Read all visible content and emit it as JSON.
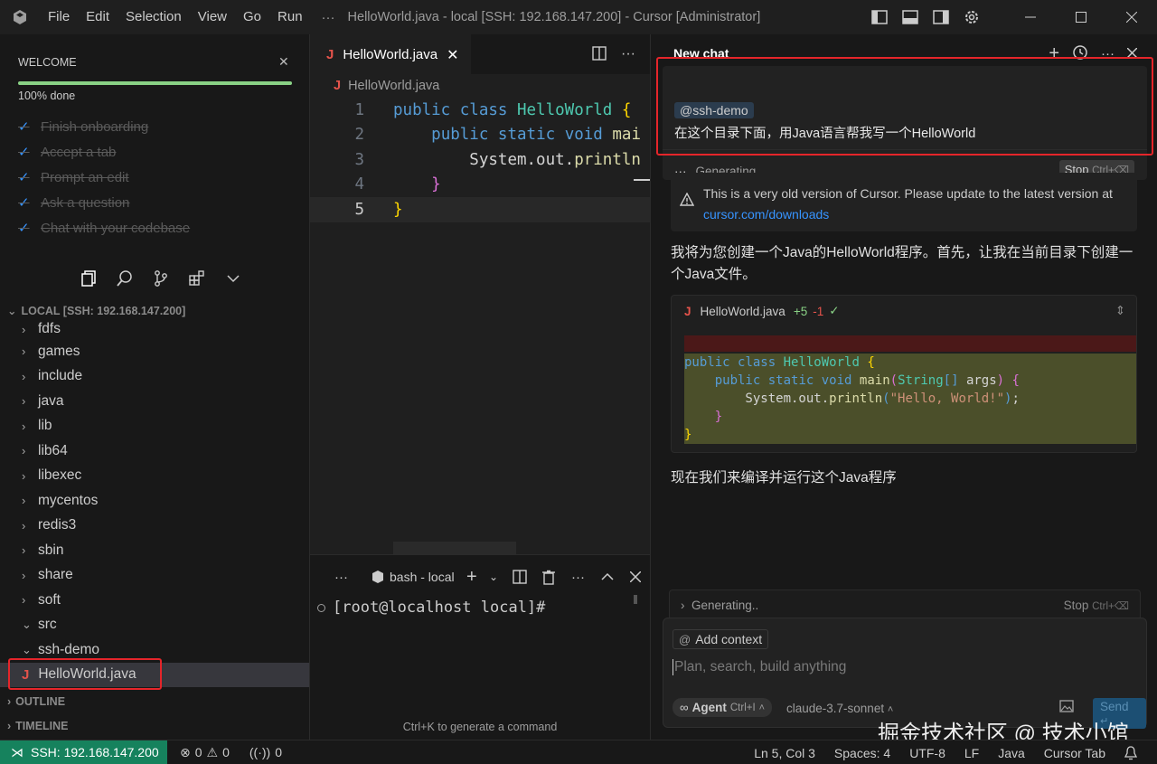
{
  "titlebar": {
    "menus": [
      "File",
      "Edit",
      "Selection",
      "View",
      "Go",
      "Run"
    ],
    "more": "···",
    "title": "HelloWorld.java - local [SSH: 192.168.147.200] - Cursor [Administrator]"
  },
  "welcome": {
    "header": "WELCOME",
    "progress_label": "100% done",
    "progress": 1.0,
    "steps": [
      "Finish onboarding",
      "Accept a tab",
      "Prompt an edit",
      "Ask a question",
      "Chat with your codebase"
    ]
  },
  "explorer": {
    "header": "LOCAL [SSH: 192.168.147.200]",
    "folders": [
      "fdfs",
      "games",
      "include",
      "java",
      "lib",
      "lib64",
      "libexec",
      "mycentos",
      "redis3",
      "sbin",
      "share",
      "soft",
      "src",
      "ssh-demo"
    ],
    "selected_file": "HelloWorld.java",
    "outline": "OUTLINE",
    "timeline": "TIMELINE"
  },
  "editor": {
    "tab_label": "HelloWorld.java",
    "breadcrumb": "HelloWorld.java",
    "lines": [
      {
        "n": "1",
        "indent": "",
        "parts": [
          [
            "kw",
            "public "
          ],
          [
            "kw",
            "class "
          ],
          [
            "cls",
            "HelloWorld "
          ],
          [
            "br",
            "{"
          ]
        ]
      },
      {
        "n": "2",
        "indent": "    ",
        "parts": [
          [
            "kw",
            "public "
          ],
          [
            "kw",
            "static "
          ],
          [
            "kw",
            "void "
          ],
          [
            "fn",
            "mai"
          ]
        ]
      },
      {
        "n": "3",
        "indent": "        ",
        "parts": [
          [
            "plain",
            "System.out."
          ],
          [
            "fn",
            "println"
          ]
        ]
      },
      {
        "n": "4",
        "indent": "    ",
        "parts": [
          [
            "br2",
            "}"
          ]
        ]
      },
      {
        "n": "5",
        "indent": "",
        "parts": [
          [
            "br",
            "}"
          ]
        ]
      }
    ]
  },
  "terminal": {
    "more": "···",
    "tab_label": "bash - local",
    "prompt": "[root@localhost local]#",
    "hint": "Ctrl+K to generate a command"
  },
  "chat": {
    "title": "New chat",
    "user_message": {
      "mention": "@ssh-demo",
      "text": "在这个目录下面，用Java语言帮我写一个HelloWorld",
      "status": "Generating",
      "stop_label": "Stop",
      "stop_shortcut": "Ctrl+⌫"
    },
    "warning": {
      "text": "This is a very old version of Cursor. Please update to the latest version at ",
      "link": "cursor.com/downloads"
    },
    "response1": "我将为您创建一个Java的HelloWorld程序。首先，让我在当前目录下创建一个Java文件。",
    "diff": {
      "file": "HelloWorld.java",
      "added": "+5",
      "removed": "-1",
      "lines": [
        [
          [
            "kw",
            "public "
          ],
          [
            "kw",
            "class "
          ],
          [
            "cls",
            "HelloWorld "
          ],
          [
            "br",
            "{"
          ]
        ],
        [
          [
            "plain",
            "    "
          ],
          [
            "kw",
            "public "
          ],
          [
            "kw",
            "static "
          ],
          [
            "kw",
            "void "
          ],
          [
            "fn",
            "main"
          ],
          [
            "br2",
            "("
          ],
          [
            "cls",
            "String"
          ],
          [
            "kw",
            "[] "
          ],
          [
            "plain",
            "args"
          ],
          [
            "br2",
            ")"
          ],
          [
            "plain",
            " "
          ],
          [
            "br2",
            "{"
          ]
        ],
        [
          [
            "plain",
            "        System.out."
          ],
          [
            "fn",
            "println"
          ],
          [
            "kw",
            "("
          ],
          [
            "str",
            "\"Hello, World!\""
          ],
          [
            "kw",
            ")"
          ],
          [
            "plain",
            ";"
          ]
        ],
        [
          [
            "plain",
            "    "
          ],
          [
            "br2",
            "}"
          ]
        ],
        [
          [
            "br",
            "}"
          ]
        ]
      ]
    },
    "response2": "现在我们来编译并运行这个Java程序",
    "generating_bar": {
      "label": "Generating..",
      "stop_label": "Stop",
      "stop_shortcut": "Ctrl+⌫"
    },
    "input": {
      "add_context": "Add context",
      "placeholder": "Plan, search, build anything",
      "agent_label": "Agent",
      "agent_shortcut": "Ctrl+I",
      "model": "claude-3.7-sonnet",
      "send_label": "Send"
    }
  },
  "watermark": "掘金技术社区 @ 技术小馆",
  "statusbar": {
    "remote": "SSH: 192.168.147.200",
    "errors": "0",
    "warnings": "0",
    "ports": "0",
    "position": "Ln 5, Col 3",
    "spaces": "Spaces: 4",
    "encoding": "UTF-8",
    "eol": "LF",
    "language": "Java",
    "cursor_tab": "Cursor Tab"
  },
  "colors": {
    "accent": "#3794ff",
    "remote_bg": "#16825d",
    "highlight_red": "#e5252a",
    "java_icon": "#e5534b",
    "progress_fill": "#89d185"
  }
}
